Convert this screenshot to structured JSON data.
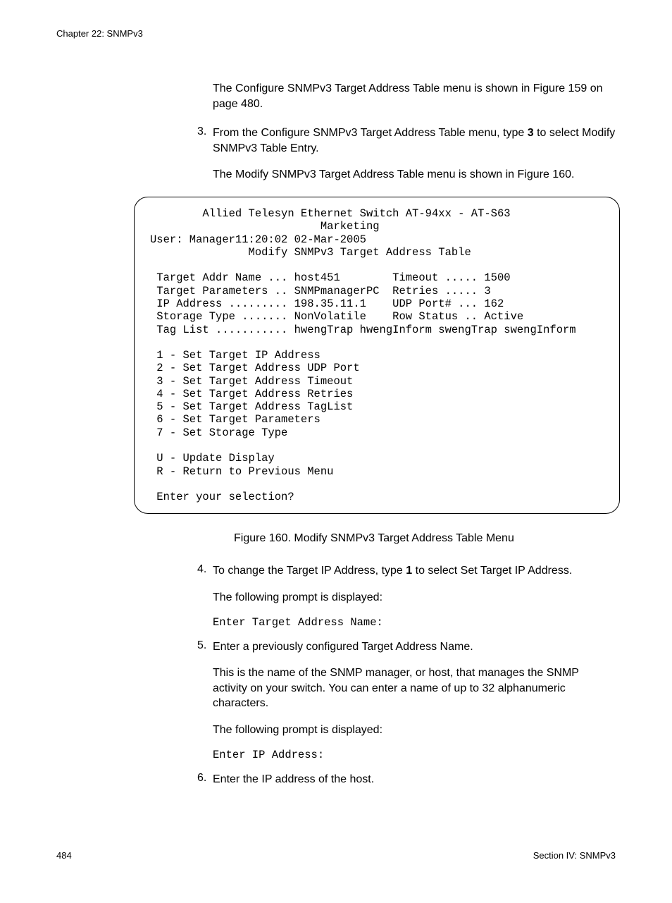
{
  "header": "Chapter 22: SNMPv3",
  "intro_para": "The Configure SNMPv3 Target Address Table menu is shown in Figure 159 on page 480.",
  "step3": {
    "num": "3.",
    "line1a": "From the Configure SNMPv3 Target Address Table menu, type ",
    "line1b": "3",
    "line1c": " to select Modify SNMPv3 Table Entry.",
    "sub": "The Modify SNMPv3 Target Address Table menu is shown in Figure 160."
  },
  "terminal": "        Allied Telesyn Ethernet Switch AT-94xx - AT-S63\n                          Marketing\nUser: Manager11:20:02 02-Mar-2005\n               Modify SNMPv3 Target Address Table\n\n Target Addr Name ... host451        Timeout ..... 1500\n Target Parameters .. SNMPmanagerPC  Retries ..... 3\n IP Address ......... 198.35.11.1    UDP Port# ... 162\n Storage Type ....... NonVolatile    Row Status .. Active\n Tag List ........... hwengTrap hwengInform swengTrap swengInform\n\n 1 - Set Target IP Address\n 2 - Set Target Address UDP Port\n 3 - Set Target Address Timeout\n 4 - Set Target Address Retries\n 5 - Set Target Address TagList\n 6 - Set Target Parameters\n 7 - Set Storage Type\n\n U - Update Display\n R - Return to Previous Menu\n\n Enter your selection?",
  "fig_caption": "Figure 160. Modify SNMPv3 Target Address Table Menu",
  "step4": {
    "num": "4.",
    "line1a": "To change the Target IP Address, type ",
    "line1b": "1",
    "line1c": " to select Set Target IP Address.",
    "sub1": "The following prompt is displayed:",
    "prompt": "Enter Target Address Name:"
  },
  "step5": {
    "num": "5.",
    "line1": "Enter a previously configured Target Address Name.",
    "sub1": "This is the name of the SNMP manager, or host, that manages the SNMP activity on your switch. You can enter a name of up to 32 alphanumeric characters.",
    "sub2": "The following prompt is displayed:",
    "prompt": "Enter IP Address:"
  },
  "step6": {
    "num": "6.",
    "line1": "Enter the IP address of the host."
  },
  "footer_left": "484",
  "footer_right": "Section IV: SNMPv3"
}
